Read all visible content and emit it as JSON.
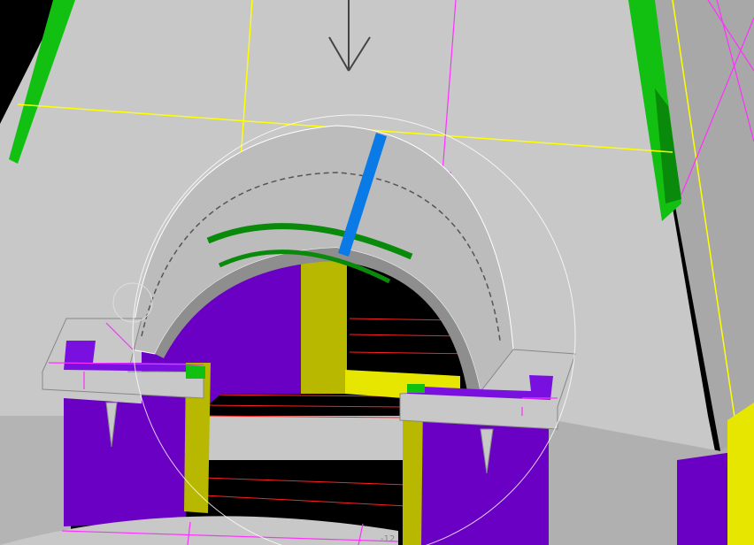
{
  "viewport": {
    "background": "#000000",
    "colors": {
      "surface_light": "#c8c8c8",
      "surface_mid": "#b4b4b4",
      "surface_dark": "#8e8e8e",
      "purple": "#6a00c4",
      "purple_bright": "#7a10e0",
      "yellow": "#b8b800",
      "yellow_bright": "#e6e600",
      "green": "#12c012",
      "green_dark": "#0a8a0a",
      "blue": "#0a7ae6",
      "magenta_line": "#ff30ff",
      "yellow_line": "#ffff00",
      "red_line": "#ff2020",
      "gizmo": "#ffffff"
    },
    "icons": [
      "down-arrow-icon",
      "rotate-gizmo-icon"
    ]
  },
  "labels": {
    "bottom_fragment": "-12"
  }
}
